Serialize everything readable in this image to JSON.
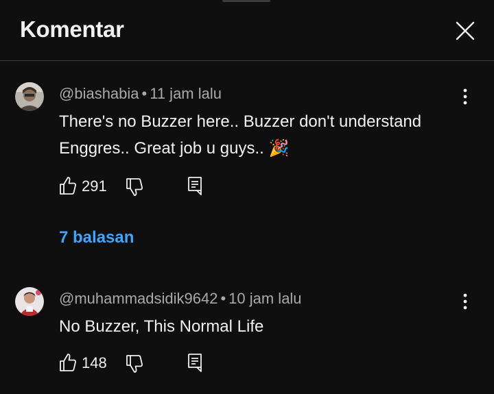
{
  "panel": {
    "title": "Komentar",
    "close_icon": "close-icon"
  },
  "comments": [
    {
      "author": "@biashabia",
      "separator": "•",
      "time": "11 jam lalu",
      "text": "There's no Buzzer here.. Buzzer don't understand Enggres.. Great job u guys.. 🎉",
      "likes": "291",
      "replies_label": "7 balasan",
      "avatar_icon": "avatar-person"
    },
    {
      "author": "@muhammadsidik9642",
      "separator": "•",
      "time": "10 jam lalu",
      "text": "No Buzzer, This Normal Life",
      "likes": "148",
      "avatar_icon": "avatar-person"
    }
  ],
  "colors": {
    "background": "#0f0f0f",
    "text_primary": "#f1f1f1",
    "text_secondary": "#aaaaaa",
    "link": "#3ea6ff",
    "divider": "#3f3f3f"
  }
}
